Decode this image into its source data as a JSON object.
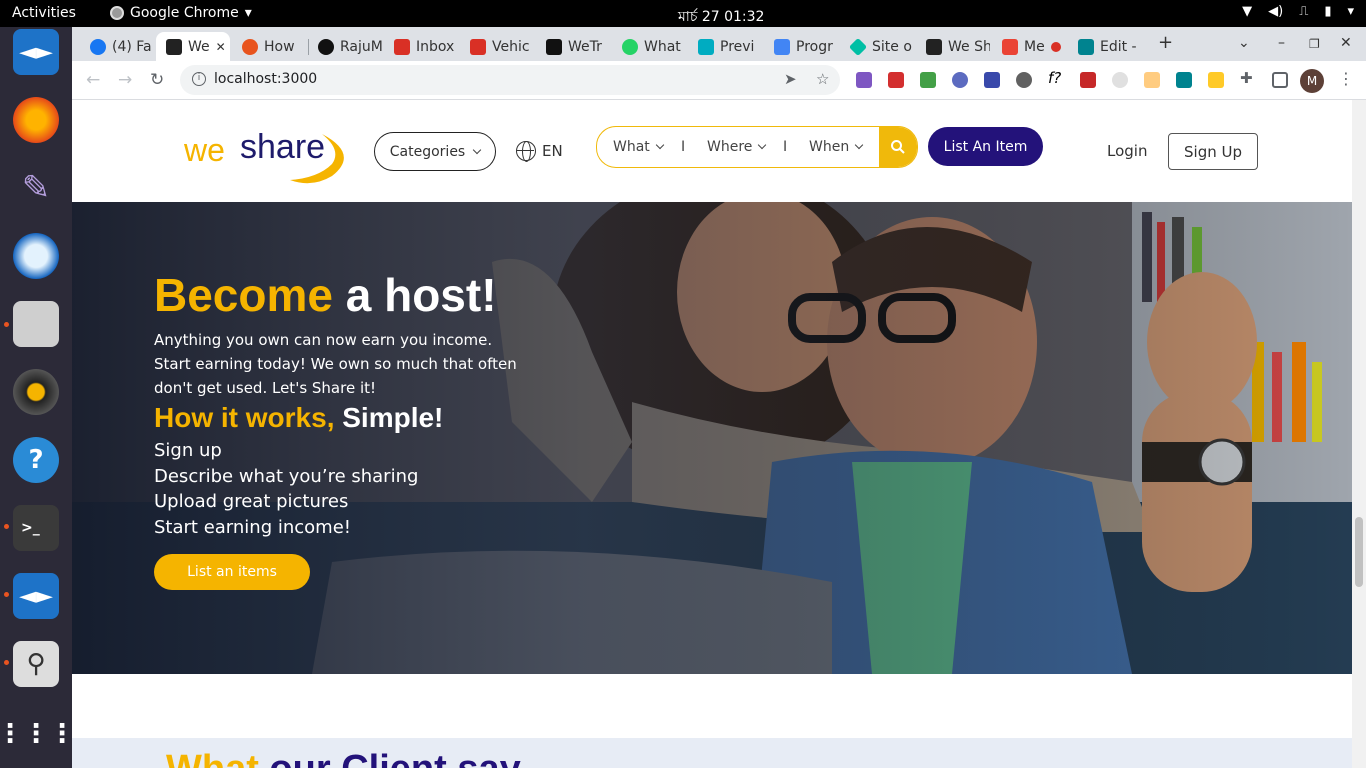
{
  "os": {
    "activities": "Activities",
    "app_name": "Google Chrome",
    "clock": "মার্চ 27  01:32"
  },
  "browser": {
    "tabs": [
      {
        "label": "(4) Fa",
        "color": "#1877f2"
      },
      {
        "label": "We",
        "color": "#222",
        "active": true
      },
      {
        "label": "How",
        "color": "#e8541e"
      },
      {
        "label": "RajuM",
        "color": "#111"
      },
      {
        "label": "Inbox",
        "color": "#d93025"
      },
      {
        "label": "Vehic",
        "color": "#d93025"
      },
      {
        "label": "WeTr",
        "color": "#111"
      },
      {
        "label": "What",
        "color": "#25d366"
      },
      {
        "label": "Previ",
        "color": "#00acc1"
      },
      {
        "label": "Progr",
        "color": "#4285f4"
      },
      {
        "label": "Site o",
        "color": "#00bfa5"
      },
      {
        "label": "We Sh",
        "color": "#222"
      },
      {
        "label": "Me",
        "color": "#ea4335"
      },
      {
        "label": "Edit -",
        "color": "#00838f"
      }
    ],
    "url": "localhost:3000",
    "profile_initial": "M"
  },
  "site": {
    "logo_we": "we",
    "logo_share": "share",
    "categories_label": "Categories",
    "language": "EN",
    "search": {
      "what": "What",
      "where": "Where",
      "when": "When",
      "separator": "I"
    },
    "list_item_label": "List An Item",
    "login_label": "Login",
    "signup_label": "Sign Up"
  },
  "hero": {
    "title_highlight": "Become",
    "title_rest": " a host!",
    "description": "Anything you own can now earn you income. Start earning today! We own so much that often don't get used. Let's Share it!",
    "subtitle_highlight": "How it works,",
    "subtitle_rest": " Simple!",
    "steps": [
      "Sign up",
      "Describe what you’re sharing",
      "Upload great pictures",
      "Start earning income!"
    ],
    "cta_label": "List an items"
  },
  "testimonials": {
    "title_highlight": "What",
    "title_rest": " our Client say"
  },
  "colors": {
    "brand_yellow": "#f5b400",
    "brand_navy": "#23127a"
  }
}
